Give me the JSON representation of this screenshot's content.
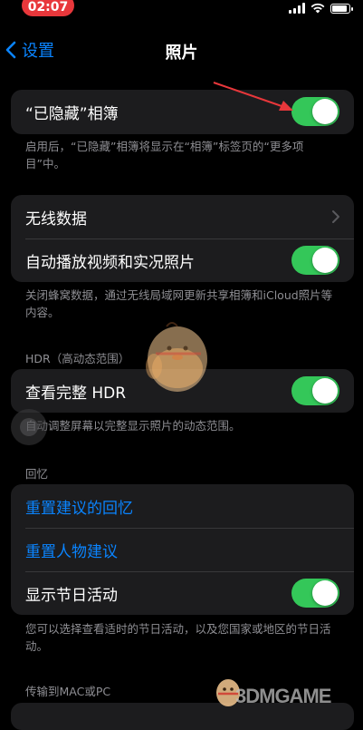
{
  "status_bar": {
    "time": "02:07",
    "battery_level": 0.8
  },
  "nav": {
    "back_label": "设置",
    "title": "照片"
  },
  "hidden_album": {
    "label": "“已隐藏”相簿",
    "enabled": true,
    "footnote": "启用后，“已隐藏”相簿将显示在“相簿”标签页的“更多项目”中。"
  },
  "data_group": {
    "wireless_label": "无线数据",
    "autoplay_label": "自动播放视频和实况照片",
    "autoplay_enabled": true,
    "footnote": "关闭蜂窝数据，通过无线局域网更新共享相簿和iCloud照片等内容。"
  },
  "hdr": {
    "header": "HDR（高动态范围）",
    "label": "查看完整 HDR",
    "enabled": true,
    "footnote": "自动调整屏幕以完整显示照片的动态范围。"
  },
  "memories": {
    "header": "回忆",
    "reset_memories_label": "重置建议的回忆",
    "reset_people_label": "重置人物建议",
    "holidays_label": "显示节日活动",
    "holidays_enabled": true,
    "footnote": "您可以选择查看适时的节日活动，以及您国家或地区的节日活动。"
  },
  "transfer": {
    "header": "传输到MAC或PC"
  },
  "watermark": {
    "text": "3DMGAME"
  },
  "colors": {
    "accent": "#0a84ff",
    "toggle_on": "#34c759",
    "arrow": "#e8373b"
  }
}
